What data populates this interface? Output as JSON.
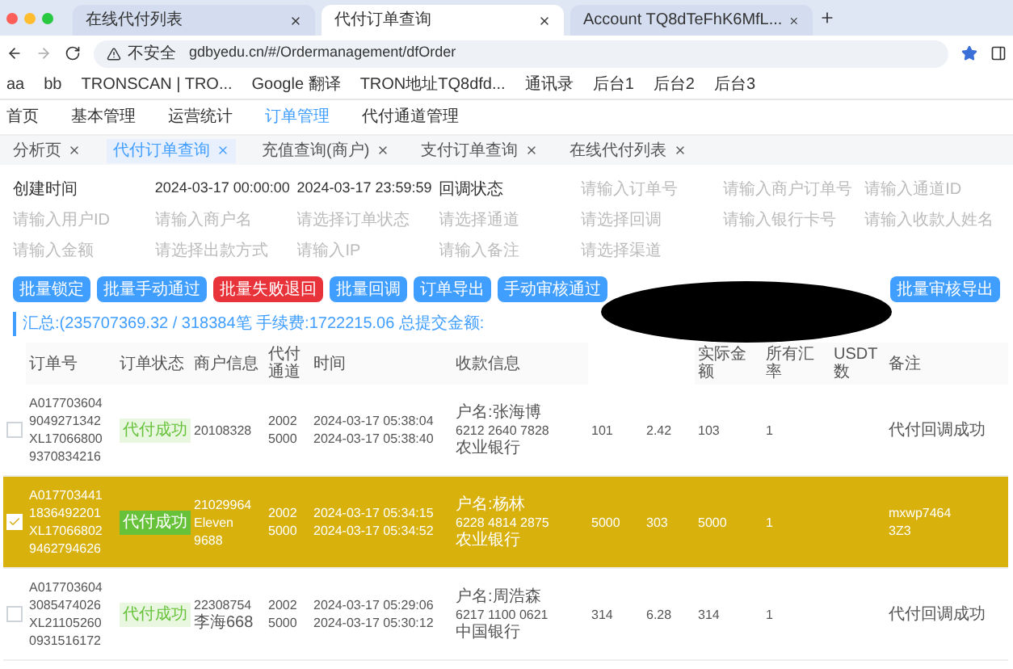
{
  "browser": {
    "tabs": [
      {
        "title": "在线代付列表",
        "selected": false
      },
      {
        "title": "代付订单查询",
        "selected": true
      },
      {
        "title": "Account TQ8dTeFhK6MfL...",
        "selected": false
      }
    ],
    "security": "不安全",
    "url": "gdbyedu.cn/#/Ordermanagement/dfOrder",
    "bookmarks": [
      "aa",
      "bb",
      "TRONSCAN | TRO...",
      "Google 翻译",
      "TRON地址TQ8dfd...",
      "通讯录",
      "后台1",
      "后台2",
      "后台3"
    ]
  },
  "menu": [
    {
      "label": "首页",
      "selected": false
    },
    {
      "label": "基本管理",
      "selected": false
    },
    {
      "label": "运营统计",
      "selected": false
    },
    {
      "label": "订单管理",
      "selected": true
    },
    {
      "label": "代付通道管理",
      "selected": false
    }
  ],
  "page_tabs": [
    {
      "label": "分析页",
      "selected": false
    },
    {
      "label": "代付订单查询",
      "selected": true
    },
    {
      "label": "充值查询(商户)",
      "selected": false
    },
    {
      "label": "支付订单查询",
      "selected": false
    },
    {
      "label": "在线代付列表",
      "selected": false
    }
  ],
  "filters": {
    "label": "创建时间",
    "start": "2024-03-17 00:00:00",
    "end": "2024-03-17 23:59:59",
    "status_label": "回调状态",
    "placeholders": [
      "请输入订单号",
      "请输入商户订单号",
      "请输入通道ID",
      "请输入用户ID",
      "请输入商户名",
      "请选择订单状态",
      "请选择通道",
      "请选择回调",
      "请输入银行卡号",
      "请输入收款人姓名",
      "请输入金额",
      "请选择出款方式",
      "请输入IP",
      "请输入备注",
      "请选择渠道"
    ]
  },
  "buttons": [
    {
      "label": "批量锁定",
      "kind": "primary"
    },
    {
      "label": "批量手动通过",
      "kind": "primary"
    },
    {
      "label": "批量失败退回",
      "kind": "danger"
    },
    {
      "label": "批量回调",
      "kind": "primary"
    },
    {
      "label": "订单导出",
      "kind": "primary"
    },
    {
      "label": "手动审核通过",
      "kind": "primary"
    },
    {
      "label": "批量审核导出",
      "kind": "primary"
    }
  ],
  "summary": "汇总:(235707369.32 / 318384笔 手续费:1722215.06 总提交金额:",
  "table": {
    "columns": [
      {
        "label": "订单号"
      },
      {
        "label": "订单状态"
      },
      {
        "label": "商户信息"
      },
      {
        "label": "代付通道"
      },
      {
        "label": "时间"
      },
      {
        "label": "收款信息"
      },
      {},
      {},
      {
        "label": "实际金额"
      },
      {
        "label": "所有汇率"
      },
      {
        "label": "USDT数"
      },
      {
        "label": "备注"
      }
    ],
    "rows": [
      {
        "selected": false,
        "cells": [
          [
            "A017703604",
            "9049271342",
            "XL17066800",
            "9370834216"
          ],
          [
            "代付成功"
          ],
          [
            "20108328"
          ],
          [
            "2002",
            "5000"
          ],
          [
            "2024-03-17 05:38:04",
            "2024-03-17 05:38:40"
          ],
          [
            "户名:张海博",
            "6212 2640 7828",
            "农业银行"
          ],
          [
            "101"
          ],
          [
            "2.42"
          ],
          [
            "103"
          ],
          [
            "1"
          ],
          [],
          [
            "代付回调成功"
          ]
        ]
      },
      {
        "selected": true,
        "cells": [
          [
            "A017703441",
            "1836492201",
            "XL17066802",
            "9462794626"
          ],
          [
            "代付成功"
          ],
          [
            "21029964",
            "Eleven",
            "9688"
          ],
          [
            "2002",
            "5000"
          ],
          [
            "2024-03-17 05:34:15",
            "2024-03-17 05:34:52"
          ],
          [
            "户名:杨林",
            "6228 4814 2875",
            "农业银行"
          ],
          [
            "5000"
          ],
          [
            "303"
          ],
          [
            "5000"
          ],
          [
            "1"
          ],
          [],
          [
            "mxwp7464",
            "3Z3"
          ]
        ]
      },
      {
        "selected": false,
        "cells": [
          [
            "A017703604",
            "3085474026",
            "XL21105260",
            "0931516172"
          ],
          [
            "代付成功"
          ],
          [
            "22308754",
            "李海668"
          ],
          [
            "2002",
            "5000"
          ],
          [
            "2024-03-17 05:29:06",
            "2024-03-17 05:30:12"
          ],
          [
            "户名:周浩森",
            "6217 1100 0621",
            "中国银行"
          ],
          [
            "314"
          ],
          [
            "6.28"
          ],
          [
            "314"
          ],
          [
            "1"
          ],
          [],
          [
            "代付回调成功"
          ]
        ]
      }
    ]
  }
}
